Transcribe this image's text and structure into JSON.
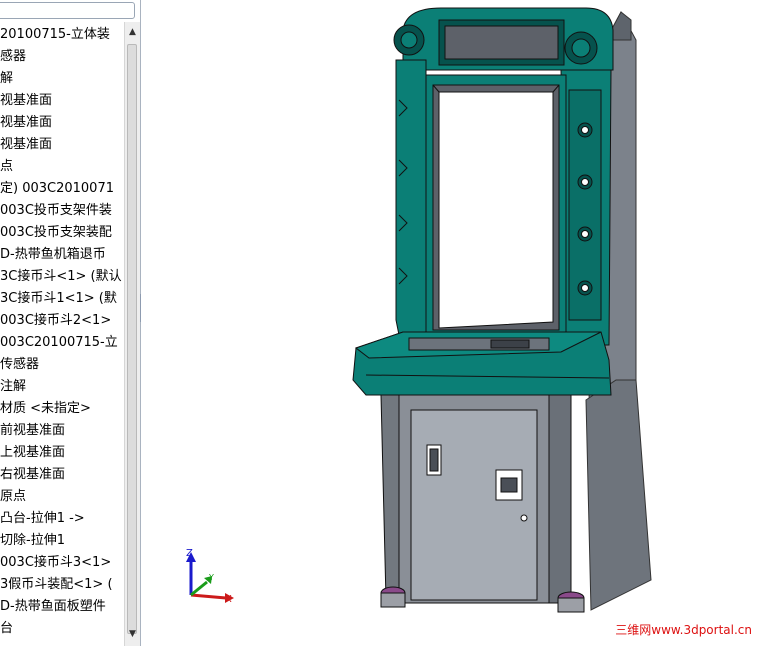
{
  "feature_tree": {
    "items": [
      {
        "label": "20100715-立体装"
      },
      {
        "label": "感器"
      },
      {
        "label": "解"
      },
      {
        "label": "视基准面"
      },
      {
        "label": "视基准面"
      },
      {
        "label": "视基准面"
      },
      {
        "label": "点"
      },
      {
        "label": "定) 003C2010071"
      },
      {
        "label": "003C投币支架件装"
      },
      {
        "label": "003C投币支架装配"
      },
      {
        "label": "D-热带鱼机箱退币"
      },
      {
        "label": "3C接币斗<1> (默认"
      },
      {
        "label": "3C接币斗1<1> (默"
      },
      {
        "label": "003C接币斗2<1> "
      },
      {
        "label": "003C20100715-立"
      },
      {
        "label": "传感器"
      },
      {
        "label": "注解"
      },
      {
        "label": "材质 <未指定>"
      },
      {
        "label": "前视基准面"
      },
      {
        "label": "上视基准面"
      },
      {
        "label": "右视基准面"
      },
      {
        "label": "原点"
      },
      {
        "label": "凸台-拉伸1 ->"
      },
      {
        "label": "切除-拉伸1"
      },
      {
        "label": "003C接币斗3<1>"
      },
      {
        "label": "3假币斗装配<1> ("
      },
      {
        "label": "D-热带鱼面板塑件"
      },
      {
        "label": "台"
      }
    ]
  },
  "scroll": {
    "up": "▲",
    "down": "▼"
  },
  "triad": {
    "z_label": "Z",
    "x_label": "X",
    "y_label": "Y"
  },
  "watermark": "三维网www.3dportal.cn",
  "colors": {
    "teal": "#0b7f76",
    "teal_dark": "#06524d",
    "gray": "#8a8f97",
    "gray_dark": "#4a4f57"
  }
}
